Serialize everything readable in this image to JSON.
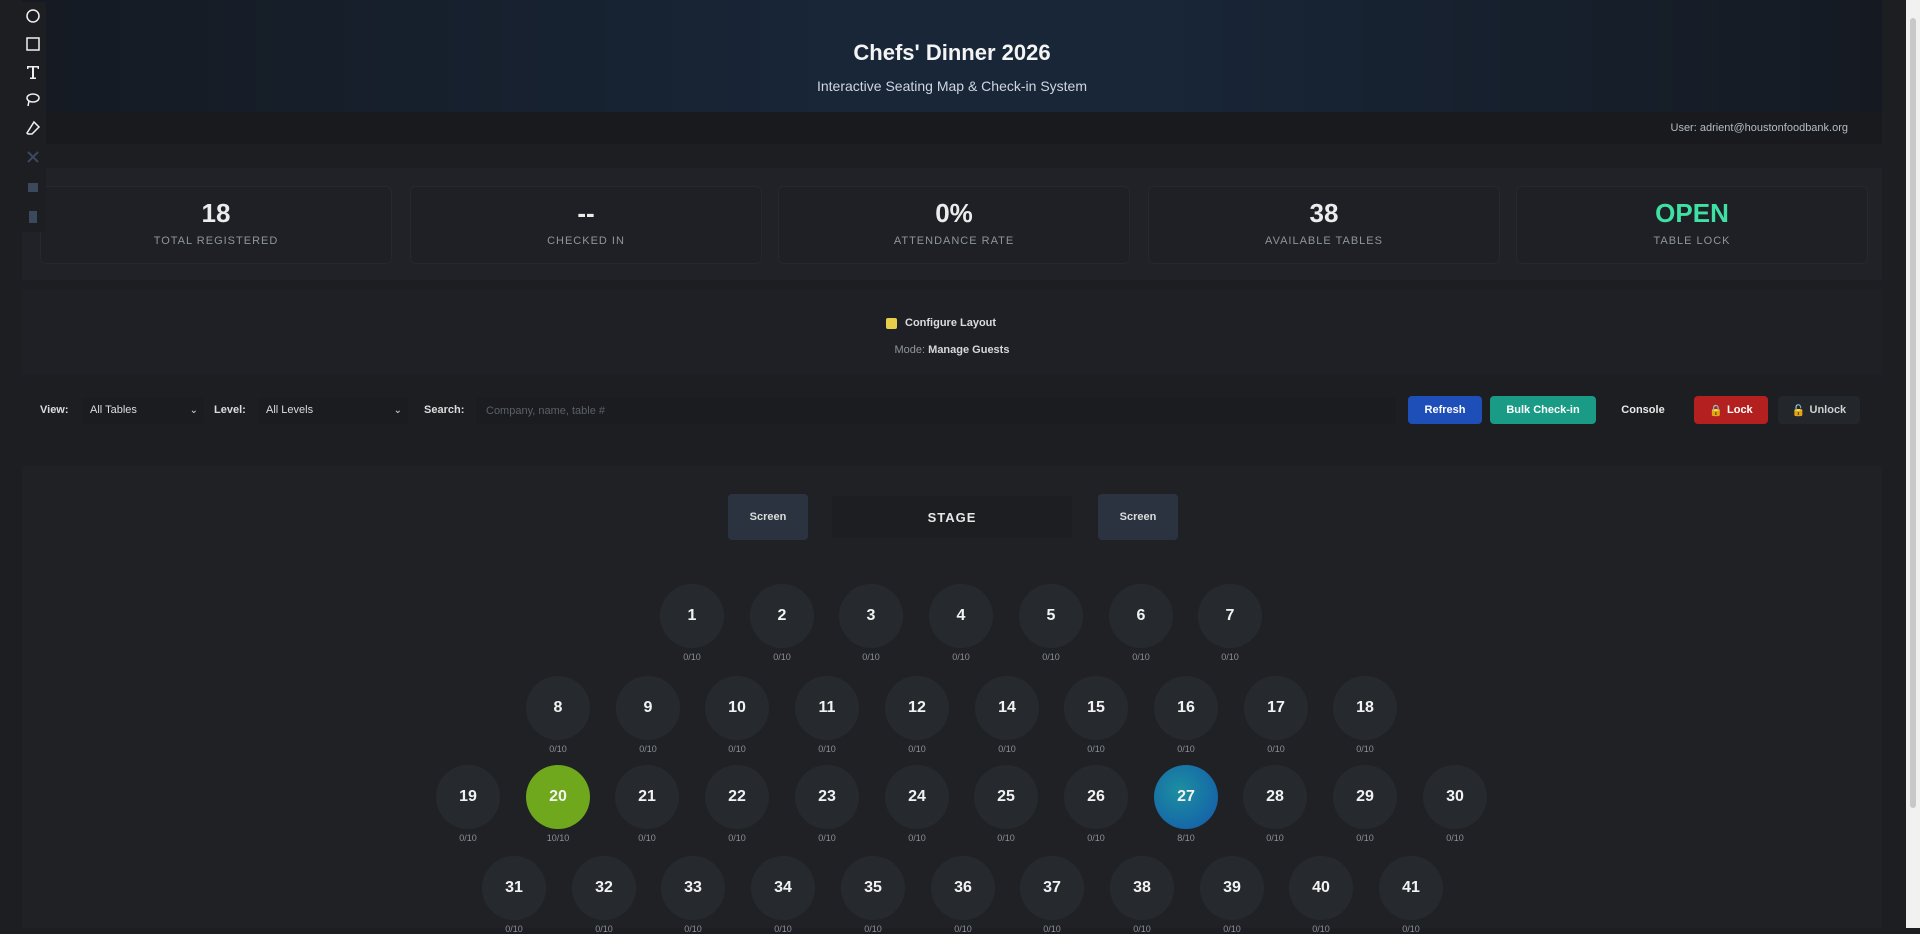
{
  "toolbar": [
    "circle-icon",
    "square-icon",
    "text-icon",
    "lasso-icon",
    "eraser-icon",
    "dim-icon-1",
    "dim-icon-2",
    "dim-icon-3"
  ],
  "header": {
    "title": "Chefs' Dinner 2026",
    "subtitle": "Interactive Seating Map & Check-in System",
    "user": "User: adrient@houstonfoodbank.org"
  },
  "stats": [
    {
      "value": "18",
      "label": "TOTAL REGISTERED"
    },
    {
      "value": "--",
      "label": "CHECKED IN"
    },
    {
      "value": "0%",
      "label": "ATTENDANCE RATE"
    },
    {
      "value": "38",
      "label": "AVAILABLE TABLES"
    },
    {
      "value": "OPEN",
      "label": "TABLE LOCK"
    }
  ],
  "config": {
    "button_label": "Configure Layout",
    "mode_label": "Mode:",
    "mode_value": "Manage Guests"
  },
  "filters": {
    "view_label": "View:",
    "view_value": "All Tables",
    "level_label": "Level:",
    "level_value": "All Levels",
    "search_label": "Search:",
    "search_placeholder": "Company, name, table #"
  },
  "actions": {
    "refresh": "Refresh",
    "bulk": "Bulk Check-in",
    "console": "Console",
    "lock": "Lock",
    "unlock": "Unlock"
  },
  "stage": {
    "left_screen": "Screen",
    "label": "STAGE",
    "right_screen": "Screen"
  },
  "tables": [
    {
      "n": "1",
      "cap": "0/10"
    },
    {
      "n": "2",
      "cap": "0/10"
    },
    {
      "n": "3",
      "cap": "0/10"
    },
    {
      "n": "4",
      "cap": "0/10"
    },
    {
      "n": "5",
      "cap": "0/10"
    },
    {
      "n": "6",
      "cap": "0/10"
    },
    {
      "n": "7",
      "cap": "0/10"
    },
    {
      "n": "8",
      "cap": "0/10"
    },
    {
      "n": "9",
      "cap": "0/10"
    },
    {
      "n": "10",
      "cap": "0/10"
    },
    {
      "n": "11",
      "cap": "0/10"
    },
    {
      "n": "12",
      "cap": "0/10"
    },
    {
      "n": "14",
      "cap": "0/10"
    },
    {
      "n": "15",
      "cap": "0/10"
    },
    {
      "n": "16",
      "cap": "0/10"
    },
    {
      "n": "17",
      "cap": "0/10"
    },
    {
      "n": "18",
      "cap": "0/10"
    },
    {
      "n": "19",
      "cap": "0/10"
    },
    {
      "n": "20",
      "cap": "10/10",
      "status": "full"
    },
    {
      "n": "21",
      "cap": "0/10"
    },
    {
      "n": "22",
      "cap": "0/10"
    },
    {
      "n": "23",
      "cap": "0/10"
    },
    {
      "n": "24",
      "cap": "0/10"
    },
    {
      "n": "25",
      "cap": "0/10"
    },
    {
      "n": "26",
      "cap": "0/10"
    },
    {
      "n": "27",
      "cap": "8/10",
      "status": "partial"
    },
    {
      "n": "28",
      "cap": "0/10"
    },
    {
      "n": "29",
      "cap": "0/10"
    },
    {
      "n": "30",
      "cap": "0/10"
    },
    {
      "n": "31",
      "cap": "0/10"
    },
    {
      "n": "32",
      "cap": "0/10"
    },
    {
      "n": "33",
      "cap": "0/10"
    },
    {
      "n": "34",
      "cap": "0/10"
    },
    {
      "n": "35",
      "cap": "0/10"
    },
    {
      "n": "36",
      "cap": "0/10"
    },
    {
      "n": "37",
      "cap": "0/10"
    },
    {
      "n": "38",
      "cap": "0/10"
    },
    {
      "n": "39",
      "cap": "0/10"
    },
    {
      "n": "40",
      "cap": "0/10"
    },
    {
      "n": "41",
      "cap": "0/10"
    }
  ]
}
